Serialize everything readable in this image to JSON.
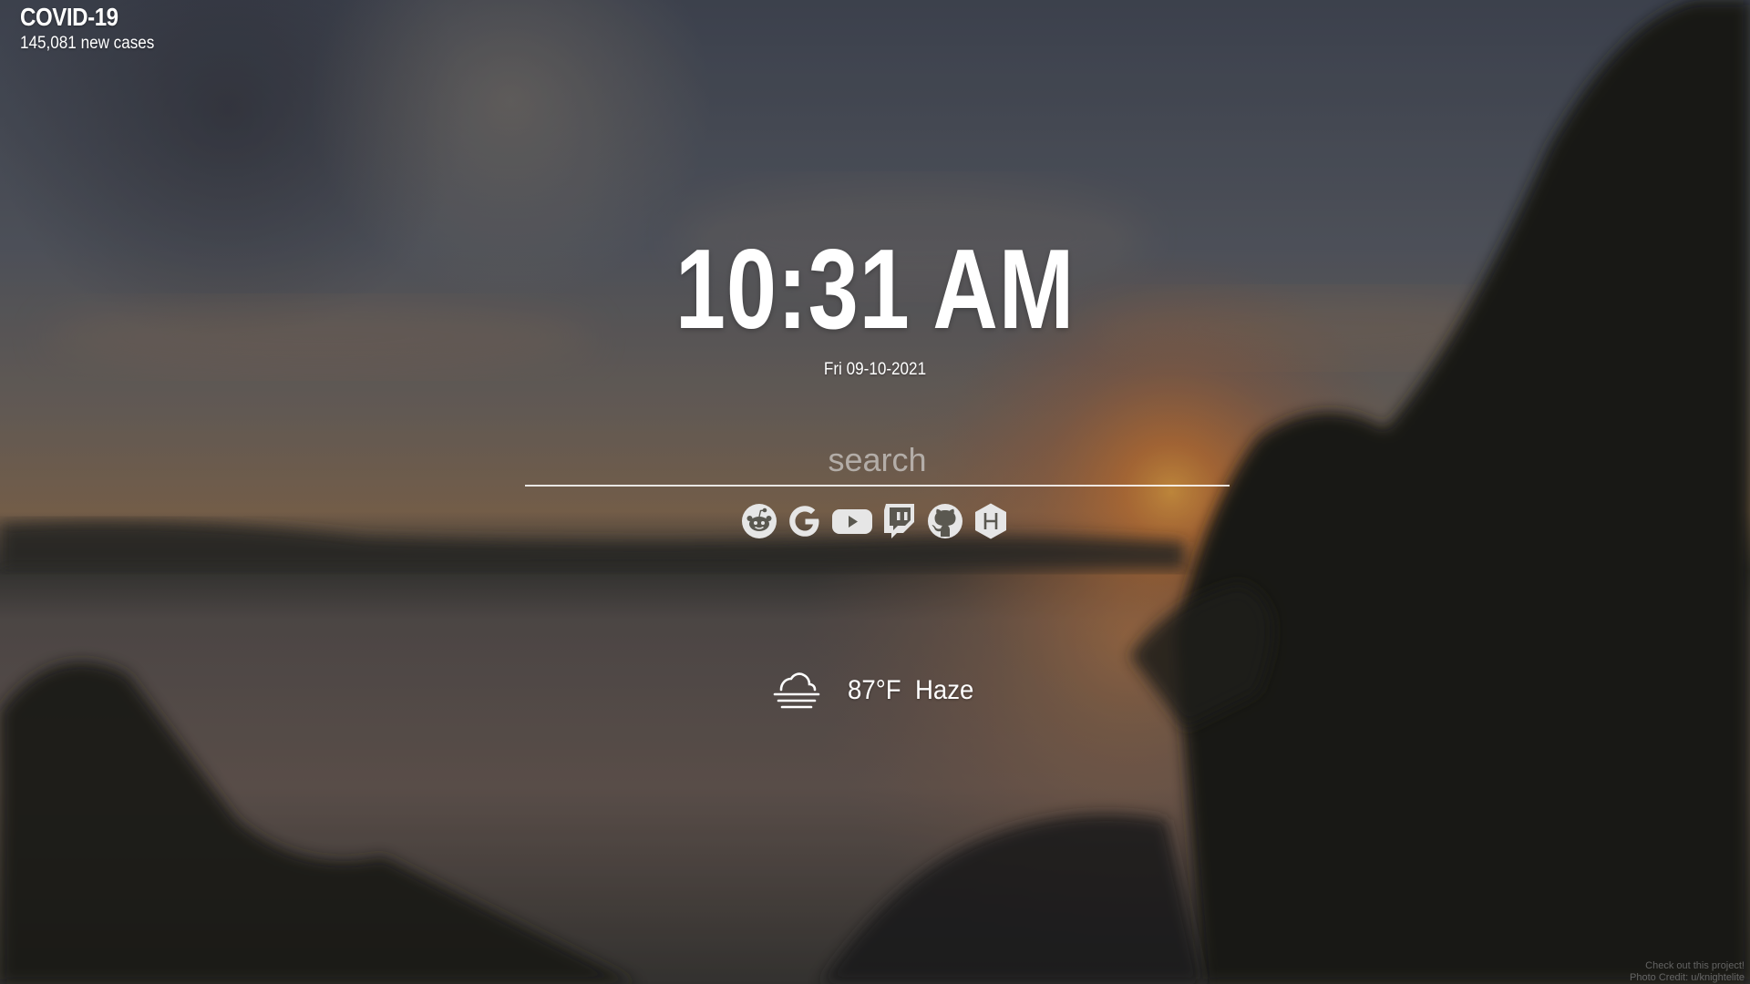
{
  "covid": {
    "title": "COVID-19",
    "subtitle": "145,081 new cases"
  },
  "clock": {
    "time": "10:31 AM",
    "date": "Fri 09-10-2021"
  },
  "search": {
    "placeholder": "search"
  },
  "shortcuts": [
    {
      "name": "Reddit",
      "icon": "reddit-icon"
    },
    {
      "name": "Google",
      "icon": "google-icon"
    },
    {
      "name": "YouTube",
      "icon": "youtube-icon"
    },
    {
      "name": "Twitch",
      "icon": "twitch-icon"
    },
    {
      "name": "GitHub",
      "icon": "github-icon"
    },
    {
      "name": "HackerRank",
      "icon": "hackerrank-icon"
    }
  ],
  "weather": {
    "icon": "haze-icon",
    "temperature": "87°F",
    "condition": "Haze"
  },
  "credits": {
    "project": "Check out this project!",
    "photo": "Photo Credit: u/knightelite"
  },
  "colors": {
    "text": "#ffffff",
    "sky_top": "#4a5261",
    "sunset": "#d9742a"
  }
}
